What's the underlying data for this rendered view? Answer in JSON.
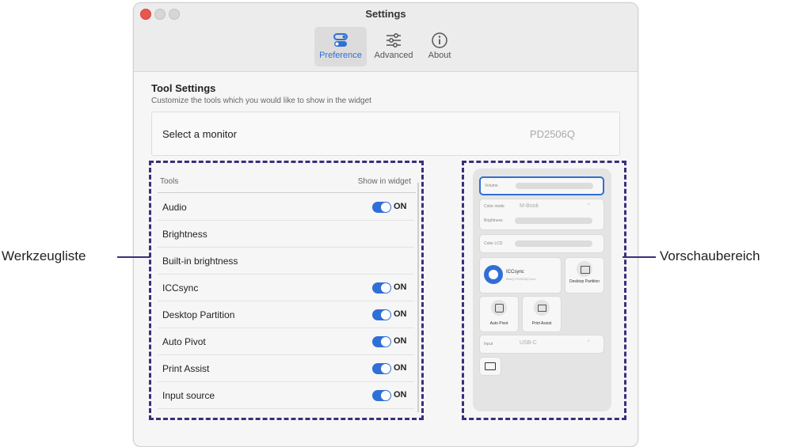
{
  "window": {
    "title": "Settings"
  },
  "toolbar": {
    "tabs": [
      {
        "label": "Preference",
        "icon": "toggle-switches-icon",
        "active": true
      },
      {
        "label": "Advanced",
        "icon": "sliders-icon",
        "active": false
      },
      {
        "label": "About",
        "icon": "info-icon",
        "active": false
      }
    ]
  },
  "tool_settings": {
    "title": "Tool Settings",
    "subtitle": "Customize the tools which you would like to show in the widget",
    "monitor_label": "Select a monitor",
    "monitor_value": "PD2506Q"
  },
  "tools_list": {
    "col_tools": "Tools",
    "col_show": "Show in widget",
    "rows": [
      {
        "name": "Audio",
        "toggle": "ON"
      },
      {
        "name": "Brightness",
        "toggle": ""
      },
      {
        "name": "Built-in brightness",
        "toggle": ""
      },
      {
        "name": "ICCsync",
        "toggle": "ON"
      },
      {
        "name": "Desktop Partition",
        "toggle": "ON"
      },
      {
        "name": "Auto Pivot",
        "toggle": "ON"
      },
      {
        "name": "Print Assist",
        "toggle": "ON"
      },
      {
        "name": "Input source",
        "toggle": "ON"
      }
    ]
  },
  "preview": {
    "volume_label": "Volume",
    "color_mode_label": "Color mode",
    "color_mode_value": "M-Book",
    "brightness_label": "Brightness",
    "color_lcd_label": "Color LCD",
    "iccsync_title": "ICCsync",
    "iccsync_sub": "BenQ PD2506Q Icon",
    "desktop_partition": "Desktop Partition",
    "auto_pivot": "Auto Pivot",
    "print_assist": "Print Assist",
    "input_label": "Input",
    "input_value": "USB-C"
  },
  "annotations": {
    "left": "Werkzeugliste",
    "right": "Vorschaubereich"
  },
  "colors": {
    "accent": "#2f6fd6",
    "annotation": "#3b2e7e",
    "close": "#e8574f"
  }
}
